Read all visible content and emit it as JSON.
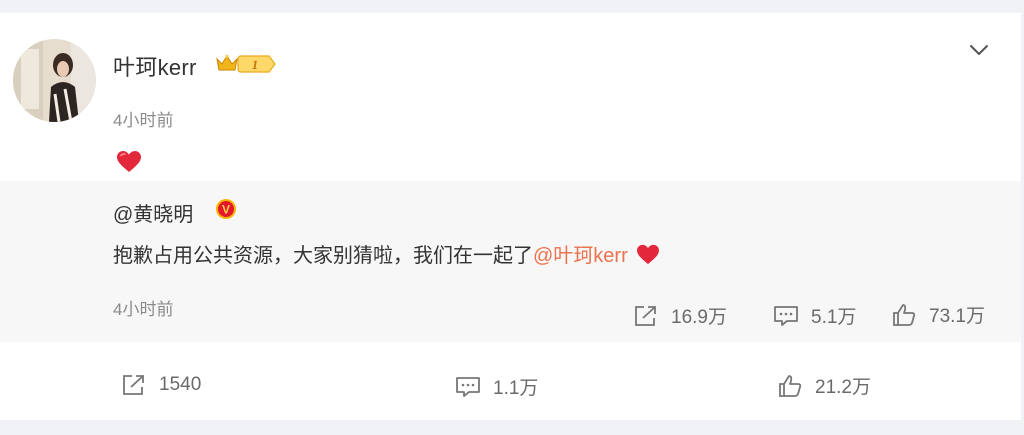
{
  "post": {
    "author": "叶珂kerr",
    "level_badge": "1",
    "time": "4小时前",
    "content_emoji": "heart-emoji"
  },
  "repost": {
    "user": "@黄晓明",
    "verified_badge": "V",
    "text_prefix": "抱歉占用公共资源，大家别猜啦，我们在一起了",
    "mention": "@叶珂kerr",
    "time": "4小时前",
    "share_count": "16.9万",
    "comment_count": "5.1万",
    "like_count": "73.1万"
  },
  "footer": {
    "share_count": "1540",
    "comment_count": "1.1万",
    "like_count": "21.2万"
  },
  "colors": {
    "mention": "#eb7350",
    "verified": "#e6162d",
    "heart": "#e2283a",
    "muted": "#8b8b8b"
  }
}
